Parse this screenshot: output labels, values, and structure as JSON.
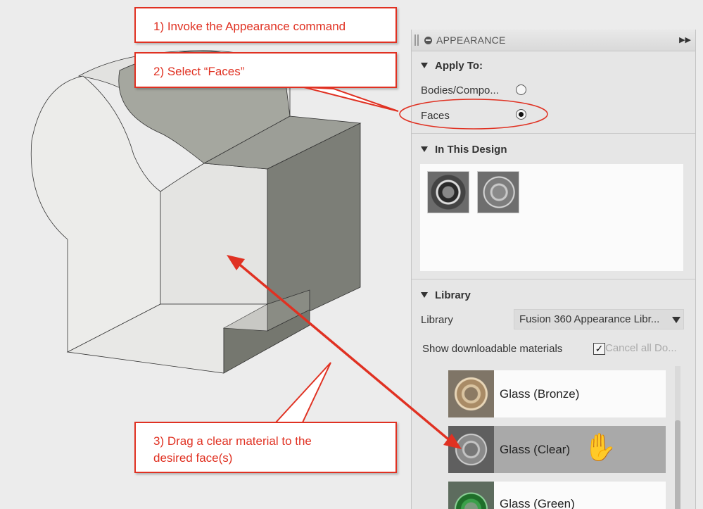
{
  "callouts": {
    "step1": "1) Invoke the Appearance command",
    "step2": "2) Select “Faces”",
    "step3_line1": "3) Drag a clear material to the",
    "step3_line2": "desired face(s)"
  },
  "panel": {
    "title": "APPEARANCE",
    "apply_to": {
      "heading": "Apply To:",
      "options": [
        {
          "label": "Bodies/Compo...",
          "selected": false
        },
        {
          "label": "Faces",
          "selected": true
        }
      ]
    },
    "in_this_design": {
      "heading": "In This Design",
      "thumbnails": [
        "chrome-torus-swatch",
        "glass-torus-swatch"
      ]
    },
    "library": {
      "heading": "Library",
      "select_label": "Library",
      "select_value": "Fusion 360 Appearance Libr...",
      "downloadable_label": "Show downloadable materials",
      "downloadable_checked": true,
      "cancel_label": "Cancel all Do...",
      "materials": [
        {
          "name": "Glass (Bronze)",
          "selected": false,
          "color": "#b58a5a"
        },
        {
          "name": "Glass (Clear)",
          "selected": true,
          "color": "#9aa3a3"
        },
        {
          "name": "Glass (Green)",
          "selected": false,
          "color": "#2f8a3a"
        }
      ]
    }
  },
  "colors": {
    "callout_red": "#e03122",
    "panel_bg": "#e6e6e6",
    "selected_row": "#a9a9a9"
  },
  "icons": {
    "collapse": "double-arrow-right-icon",
    "cursor": "grab-hand-icon"
  }
}
